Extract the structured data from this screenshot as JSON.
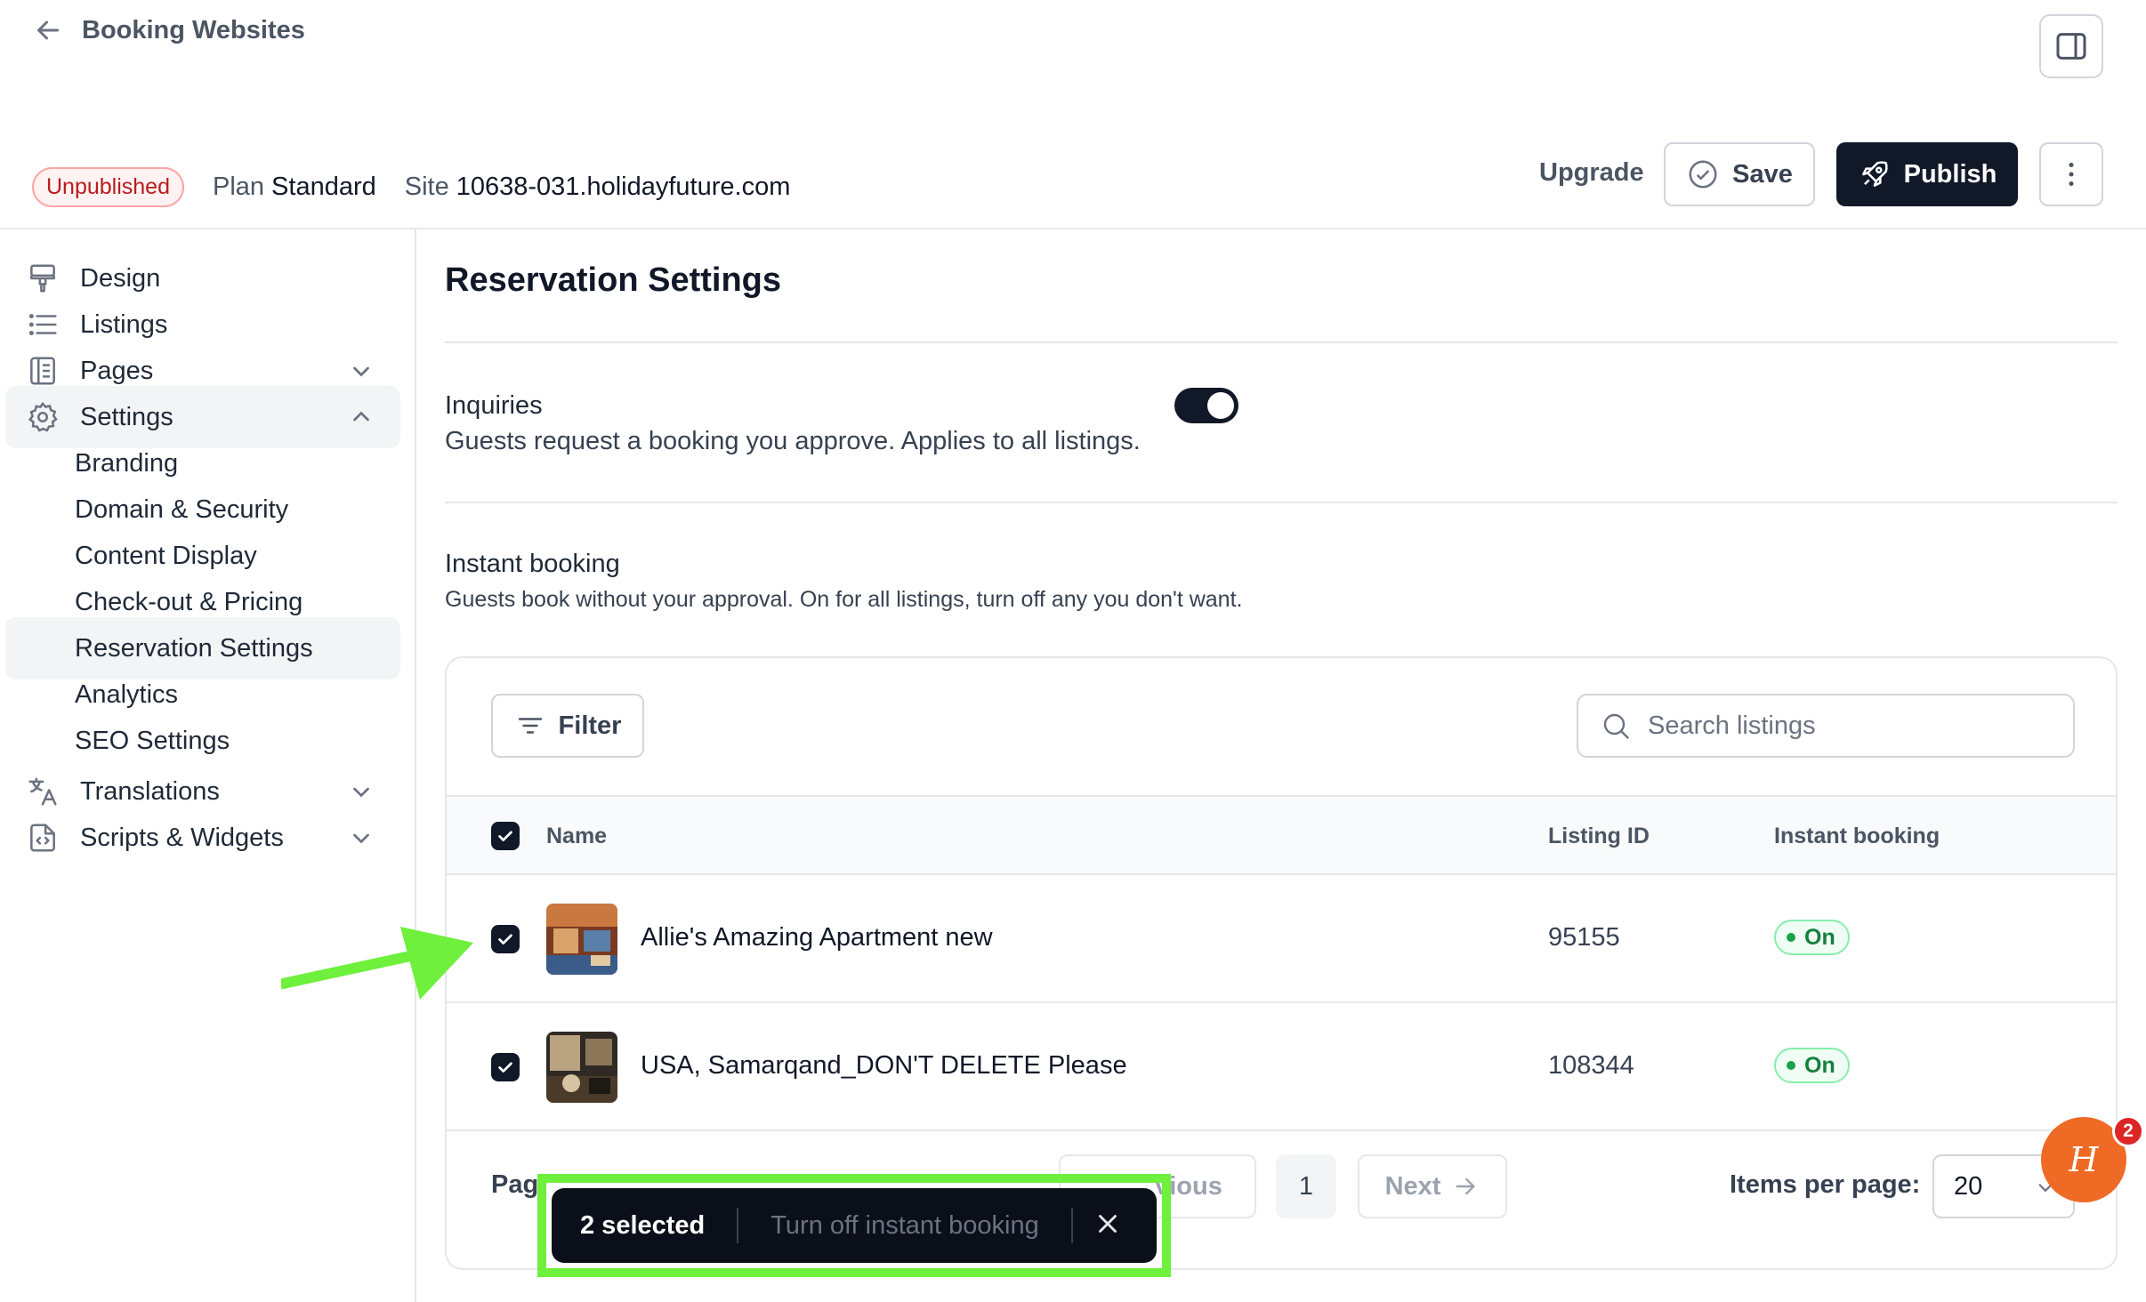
{
  "header": {
    "back_label": "Booking Websites",
    "status_badge": "Unpublished",
    "plan_label": "Plan",
    "plan_value": "Standard",
    "site_label": "Site",
    "site_value": "10638-031.holidayfuture.com",
    "upgrade_label": "Upgrade",
    "save_label": "Save",
    "publish_label": "Publish"
  },
  "sidebar": {
    "items": [
      {
        "label": "Design",
        "icon": "paint-roller-icon"
      },
      {
        "label": "Listings",
        "icon": "list-icon"
      },
      {
        "label": "Pages",
        "icon": "pages-icon"
      },
      {
        "label": "Settings",
        "icon": "gear-icon"
      },
      {
        "label": "Translations",
        "icon": "translate-icon"
      },
      {
        "label": "Scripts & Widgets",
        "icon": "code-file-icon"
      }
    ],
    "settings_sub": [
      "Branding",
      "Domain & Security",
      "Content Display",
      "Check-out & Pricing",
      "Reservation Settings",
      "Analytics",
      "SEO Settings"
    ],
    "active_sub": "Reservation Settings"
  },
  "main": {
    "title": "Reservation Settings",
    "inquiries": {
      "title": "Inquiries",
      "description": "Guests request a booking you approve. Applies to all listings.",
      "enabled": true
    },
    "instant_booking": {
      "title": "Instant booking",
      "description": "Guests book without your approval. On for all listings, turn off any you don't want."
    },
    "table": {
      "filter_label": "Filter",
      "search_placeholder": "Search listings",
      "columns": [
        "Name",
        "Listing ID",
        "Instant booking"
      ],
      "rows": [
        {
          "name": "Allie's Amazing Apartment new",
          "listing_id": "95155",
          "instant_booking": "On",
          "selected": true
        },
        {
          "name": "USA, Samarqand_DON'T DELETE Please",
          "listing_id": "108344",
          "instant_booking": "On",
          "selected": true
        }
      ]
    },
    "pagination": {
      "label_visible": "Pag",
      "prev_visible": "vious",
      "page": "1",
      "next_label": "Next",
      "items_per_page_label": "Items per page:",
      "items_per_page_value": "20"
    }
  },
  "bulk_bar": {
    "count_label": "2 selected",
    "action_label": "Turn off instant booking"
  },
  "help": {
    "badge_count": "2",
    "glyph": "H"
  },
  "colors": {
    "primary": "#111827",
    "highlight": "#6ef03c",
    "help_orange": "#ef6a25",
    "badge_red": "#dc2626",
    "status_green": "#15803d"
  }
}
